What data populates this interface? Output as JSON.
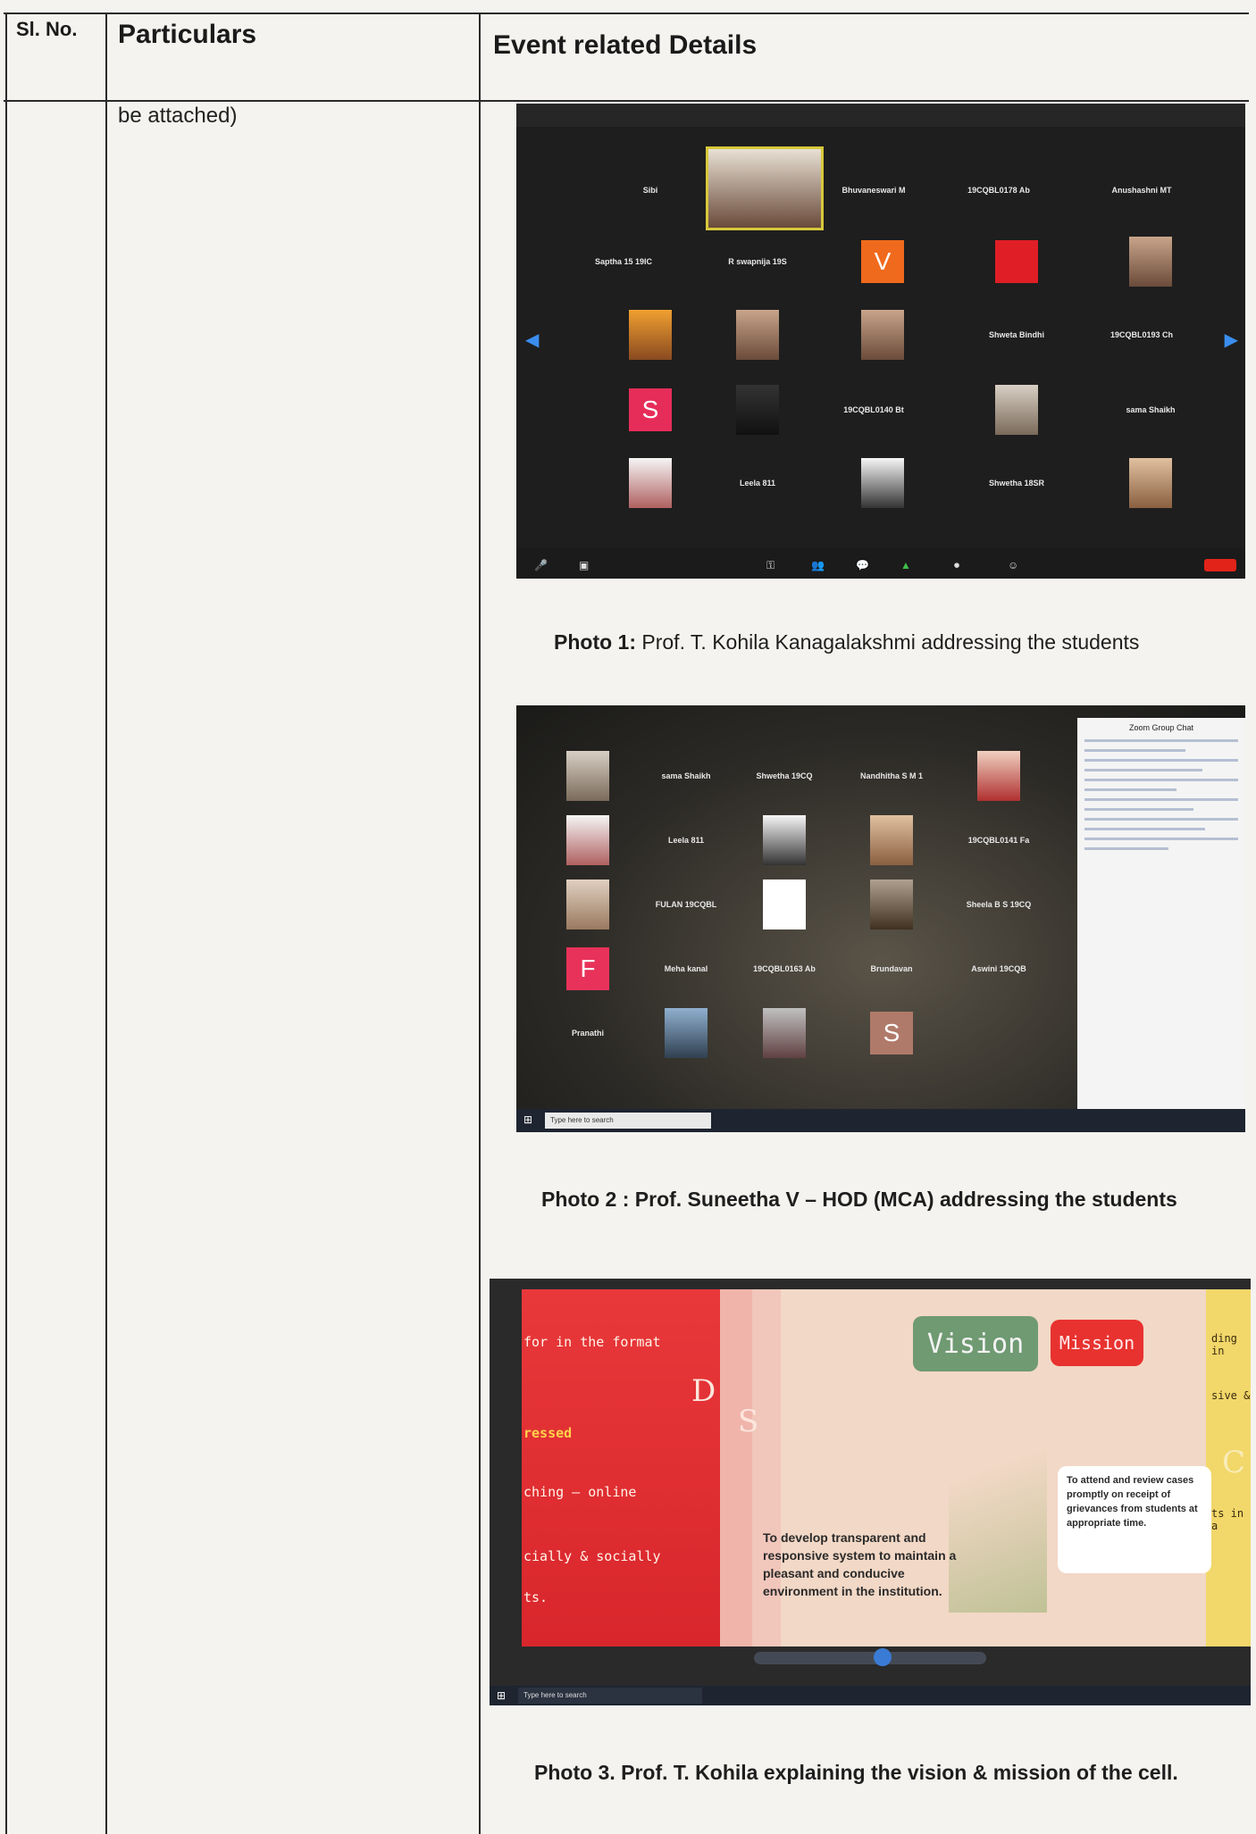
{
  "table": {
    "col1_header": "Sl. No.",
    "col2_header": "Particulars",
    "col3_header": "Event related Details",
    "particulars_text": "be attached)"
  },
  "photo1": {
    "caption_bold": "Photo 1:",
    "caption_rest": " Prof. T.  Kohila Kanagalakshmi addressing the students",
    "tiles": [
      {
        "name": "Sibi"
      },
      {
        "name": "Bhuvaneswari M"
      },
      {
        "name": "19CQBL0178 Ab"
      },
      {
        "name": "Anushashni MT"
      },
      {
        "name": "Saptha 15 19IC"
      },
      {
        "name": "R swapnija 19S"
      },
      {
        "name": "V",
        "letter": "V",
        "color": "#f06a1d"
      },
      {
        "name": "Shweta Bindhi"
      },
      {
        "name": "19CQBL0193 Ch"
      },
      {
        "name": "S",
        "letter": "S",
        "color": "#e62d5a"
      },
      {
        "name": "19CQBL0140 Bt"
      },
      {
        "name": "Leela 811"
      },
      {
        "name": "Shwetha 18SR"
      }
    ]
  },
  "photo2": {
    "caption_bold": "Photo 2 :",
    "caption_rest": " Prof. Suneetha V – HOD (MCA) addressing the students",
    "chat_title": "Zoom Group Chat",
    "search_text": "Type here to search",
    "tiles": [
      {
        "name": "sama Shaikh"
      },
      {
        "name": "Shwetha 19CQ"
      },
      {
        "name": "Nandhitha S M 1"
      },
      {
        "name": "Leela 811"
      },
      {
        "name": "19CQBL0141 Fa"
      },
      {
        "name": "FULAN 19CQBL"
      },
      {
        "name": "Sheela B S 19CQ"
      },
      {
        "name": "F",
        "letter": "F",
        "color": "#e8325a"
      },
      {
        "name": "Meha kanal"
      },
      {
        "name": "19CQBL0163 Ab"
      },
      {
        "name": "Brundavan"
      },
      {
        "name": "Aswini 19CQB"
      },
      {
        "name": "Pranathi"
      }
    ]
  },
  "photo3": {
    "caption_bold": "Photo 3. Prof. T. Kohila explaining the vision & mission of the cell.",
    "search_text": "Type here to search",
    "left_lines": [
      "for in the format",
      "ressed",
      "ching – online",
      "cially & socially",
      "ts."
    ],
    "vision_label": "Vision",
    "mission_label": "Mission",
    "vision_text": "To develop transparent and responsive system to maintain a pleasant and conducive environment in the institution.",
    "mission_text": "To attend and review cases promptly on receipt of grievances from students at appropriate time.",
    "tab_letters": [
      "D",
      "S",
      "C"
    ],
    "right_fragments": [
      "ding in",
      "sive &",
      "ts in a"
    ]
  }
}
